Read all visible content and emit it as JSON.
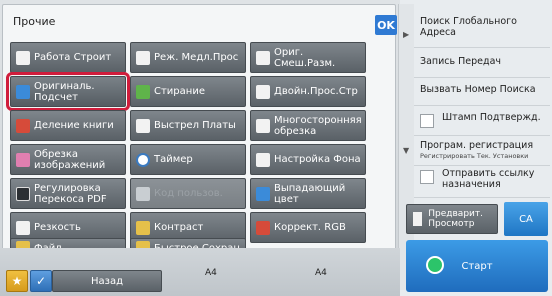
{
  "panel": {
    "title": "Прочие",
    "ok_label": "OK"
  },
  "grid": [
    {
      "label": "Работа Строит",
      "icon": "build-job-icon"
    },
    {
      "label": "Реж. Медл.Прос",
      "icon": "slow-scan-icon"
    },
    {
      "label": "Ориг. Смеш.Разм.",
      "icon": "mixed-size-original-icon"
    },
    {
      "label": "Оригиналь. Подсчет",
      "icon": "original-count-icon"
    },
    {
      "label": "Стирание",
      "icon": "erase-icon"
    },
    {
      "label": "Двойн.Прос.Стр",
      "icon": "dual-page-scan-icon"
    },
    {
      "label": "Деление книги",
      "icon": "book-divide-icon"
    },
    {
      "label": "Выстрел Платы",
      "icon": "card-shot-icon"
    },
    {
      "label": "Многосторонняя обрезка",
      "icon": "multi-crop-icon"
    },
    {
      "label": "Обрезка изображений",
      "icon": "image-crop-icon"
    },
    {
      "label": "Таймер",
      "icon": "timer-icon"
    },
    {
      "label": "Настройка Фона",
      "icon": "background-adjust-icon"
    },
    {
      "label": "Регулировка Перекоса PDF",
      "icon": "pdf-skew-icon"
    },
    {
      "label": "Код пользов.",
      "icon": "user-code-icon"
    },
    {
      "label": "Выпадающий цвет",
      "icon": "color-dropout-icon"
    },
    {
      "label": "Резкость",
      "icon": "sharpness-icon"
    },
    {
      "label": "Контраст",
      "icon": "contrast-icon"
    },
    {
      "label": "Коррект. RGB",
      "icon": "rgb-adjust-icon"
    },
    {
      "label": "Файл",
      "icon": "file-icon"
    },
    {
      "label": "Быстрое Сохран",
      "icon": "quick-save-icon"
    }
  ],
  "right": {
    "global_search": "Поиск Глобального Адреса",
    "send_log": "Запись Передач",
    "call_search_number": "Вызвать Номер Поиска",
    "verify_stamp": "Штамп Подтвержд.",
    "program_register": "Програм. регистрация",
    "program_register_sub": "Регистрировать Тек. Установки",
    "send_link": "Отправить ссылку назначения",
    "preview": "Предварит. Просмотр",
    "ca": "CA",
    "start": "Старт"
  },
  "bottom": {
    "paper1": "A4",
    "paper2": "A4",
    "back": "Назад"
  }
}
